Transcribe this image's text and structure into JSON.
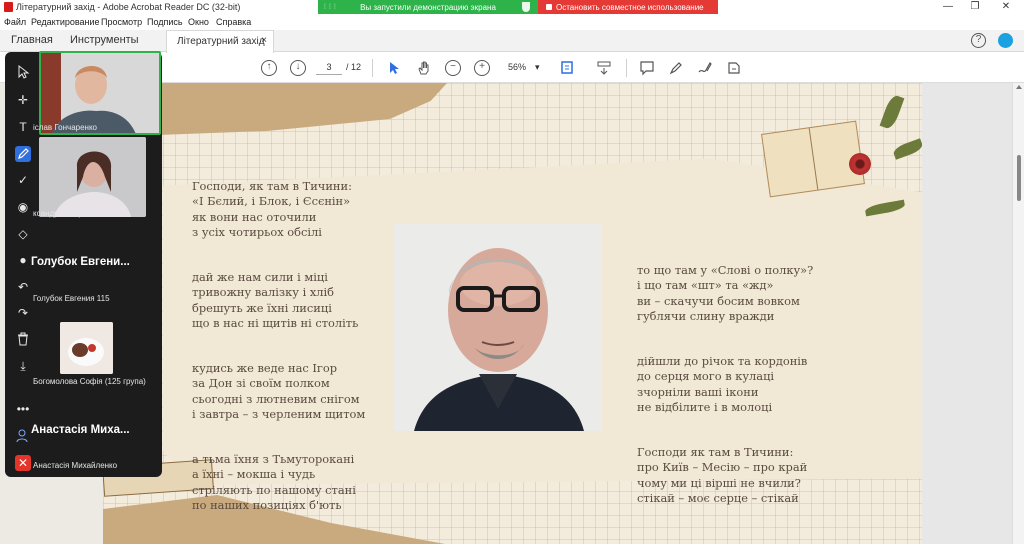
{
  "window": {
    "title": "Літературний захід - Adobe Acrobat Reader DC (32-bit)",
    "minimize": "—",
    "maximize": "❐",
    "close": "✕"
  },
  "share_banner": {
    "text": "Вы запустили демонстрацию экрана",
    "stop_label": "Остановить совместное использование",
    "color": "#2db34a",
    "stop_color": "#e53935"
  },
  "menu": [
    "Файл",
    "Редактирование",
    "Просмотр",
    "Подпись",
    "Окно",
    "Справка"
  ],
  "nav_tabs": [
    "Главная",
    "Инструменты"
  ],
  "doc_tab": {
    "label": "Літературний захід",
    "close": "×"
  },
  "toolbar": {
    "page_current": "3",
    "page_total": "/ 12",
    "zoom": "56%",
    "zoom_arrow": "▾"
  },
  "poem": {
    "left": [
      "Господи, як там в Тичини:\n«І Бєлий, і Блок, і Єсєнін»\nяк вони нас оточили\nз усіх чотирьох обсілі",
      "дай же нам сили і міці\nтривожну валізку і хліб\nбрешуть же їхні лисиці\nщо в нас ні щитів ні століть",
      "кудись же веде нас Ігор\nза Дон зі своїм полком\nсьогодні з лютневим снігом\nі завтра – з черленим щитом",
      "а тьма їхня з Тьмуторокані\nа їхні – мокша і чудь\nстріляють по нашому стані\nпо наших позиціях б'ють"
    ],
    "right": [
      "то що там у «Слові о полку»?\nі що там «шт» та «жд»\nви – скачучи босим вовком\nгублячи слину вражди",
      "дійшли до річок та кордонів\nдо серця мого в кулаці\nзчорніли ваші ікони\nне відбілите і в молоці",
      "Господи як там в Тичини:\nпро Київ – Месію – про край\nчому ми ці вірші не вчили?\nстікай – моє серце – стікай"
    ]
  },
  "meeting": {
    "participants": [
      {
        "label": "іслав Гончаренко",
        "kind": "video"
      },
      {
        "label": "ксандра Погребняк",
        "kind": "video"
      },
      {
        "big": "Голубок Евгени...",
        "label": "Голубок Евгения 115",
        "kind": "name"
      },
      {
        "label": "Богомолова Софія (125 група)",
        "kind": "photo"
      },
      {
        "big": "Анастасія Миха...",
        "label": "Анастасія Михайленко",
        "kind": "name"
      }
    ],
    "tools": [
      "cursor-icon",
      "move-icon",
      "text-icon",
      "pen-icon",
      "check-icon",
      "spotlight-icon",
      "eraser-icon",
      "color-dot-icon",
      "undo-icon",
      "redo-icon",
      "trash-icon",
      "download-icon",
      "more-icon",
      "user-settings-icon",
      "close-icon"
    ]
  }
}
